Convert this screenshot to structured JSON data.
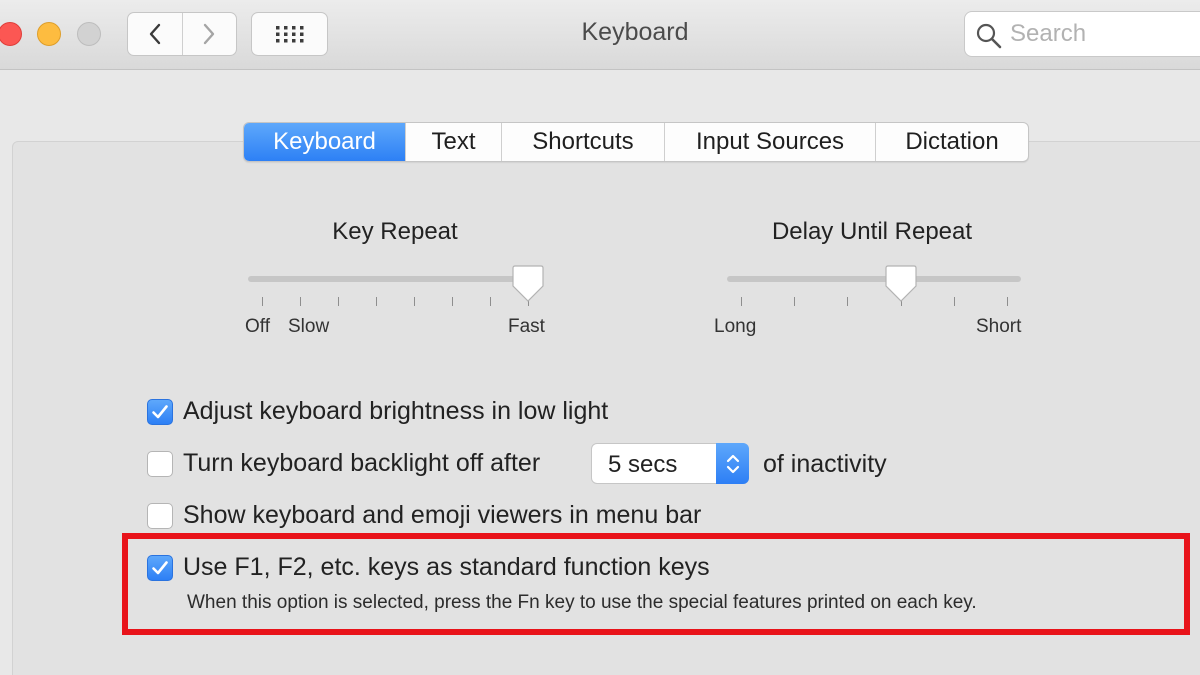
{
  "window": {
    "title": "Keyboard",
    "search_placeholder": "Search"
  },
  "toolbar": {
    "back_icon": "chevron-left-icon",
    "forward_icon": "chevron-right-icon",
    "show_all_icon": "grid-icon"
  },
  "tabs": [
    {
      "label": "Keyboard",
      "active": true
    },
    {
      "label": "Text",
      "active": false
    },
    {
      "label": "Shortcuts",
      "active": false
    },
    {
      "label": "Input Sources",
      "active": false
    },
    {
      "label": "Dictation",
      "active": false
    }
  ],
  "key_repeat": {
    "label": "Key Repeat",
    "min_label": "Off",
    "slow_label": "Slow",
    "max_label": "Fast",
    "stops": 8,
    "value_stop": 7
  },
  "delay_until_repeat": {
    "label": "Delay Until Repeat",
    "min_label": "Long",
    "max_label": "Short",
    "stops": 6,
    "value_stop": 3
  },
  "options": {
    "brightness": {
      "label": "Adjust keyboard brightness in low light",
      "checked": true
    },
    "backlight": {
      "label": "Turn keyboard backlight off after",
      "checked": false,
      "select_value": "5 secs",
      "suffix": "of inactivity"
    },
    "viewers": {
      "label": "Show keyboard and emoji viewers in menu bar",
      "checked": false
    },
    "fn_keys": {
      "label": "Use F1, F2, etc. keys as standard function keys",
      "checked": true,
      "hint": "When this option is selected, press the Fn key to use the special features printed on each key."
    }
  },
  "colors": {
    "accent": "#2d80f5",
    "highlight_box": "#e8131a"
  }
}
